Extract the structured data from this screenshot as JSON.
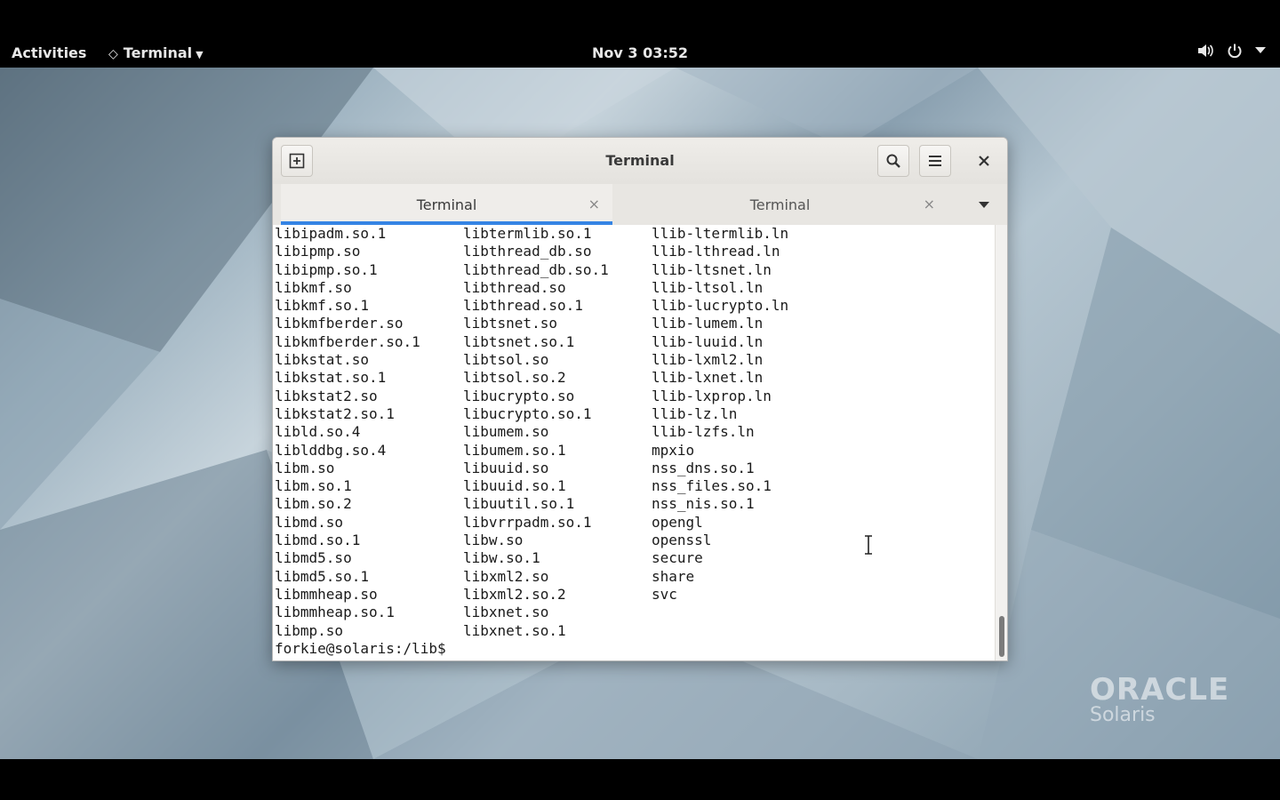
{
  "topbar": {
    "activities_label": "Activities",
    "app_menu_label": "Terminal",
    "clock": "Nov 3  03:52"
  },
  "window": {
    "title": "Terminal",
    "tabs": [
      {
        "label": "Terminal",
        "active": true
      },
      {
        "label": "Terminal",
        "active": false
      }
    ],
    "accent_color": "#3584e4"
  },
  "terminal": {
    "columns": [
      [
        "libipadm.so.1",
        "libipmp.so",
        "libipmp.so.1",
        "libkmf.so",
        "libkmf.so.1",
        "libkmfberder.so",
        "libkmfberder.so.1",
        "libkstat.so",
        "libkstat.so.1",
        "libkstat2.so",
        "libkstat2.so.1",
        "libld.so.4",
        "liblddbg.so.4",
        "libm.so",
        "libm.so.1",
        "libm.so.2",
        "libmd.so",
        "libmd.so.1",
        "libmd5.so",
        "libmd5.so.1",
        "libmmheap.so",
        "libmmheap.so.1",
        "libmp.so"
      ],
      [
        "libtermlib.so.1",
        "libthread_db.so",
        "libthread_db.so.1",
        "libthread.so",
        "libthread.so.1",
        "libtsnet.so",
        "libtsnet.so.1",
        "libtsol.so",
        "libtsol.so.2",
        "libucrypto.so",
        "libucrypto.so.1",
        "libumem.so",
        "libumem.so.1",
        "libuuid.so",
        "libuuid.so.1",
        "libuutil.so.1",
        "libvrrpadm.so.1",
        "libw.so",
        "libw.so.1",
        "libxml2.so",
        "libxml2.so.2",
        "libxnet.so",
        "libxnet.so.1"
      ],
      [
        "llib-ltermlib.ln",
        "llib-lthread.ln",
        "llib-ltsnet.ln",
        "llib-ltsol.ln",
        "llib-lucrypto.ln",
        "llib-lumem.ln",
        "llib-luuid.ln",
        "llib-lxml2.ln",
        "llib-lxnet.ln",
        "llib-lxprop.ln",
        "llib-lz.ln",
        "llib-lzfs.ln",
        "mpxio",
        "nss_dns.so.1",
        "nss_files.so.1",
        "nss_nis.so.1",
        "opengl",
        "openssl",
        "secure",
        "share",
        "svc"
      ]
    ],
    "prompt": "forkie@solaris:/lib$",
    "scroll_position": 1.0
  },
  "desktop": {
    "logo_line1": "ORACLE",
    "logo_line2": "Solaris"
  },
  "icons": [
    "new-tab-icon",
    "search-icon",
    "hamburger-menu-icon",
    "close-icon",
    "volume-icon",
    "power-icon",
    "tray-menu-caret-icon",
    "tab-list-caret-icon",
    "text-cursor-icon"
  ]
}
